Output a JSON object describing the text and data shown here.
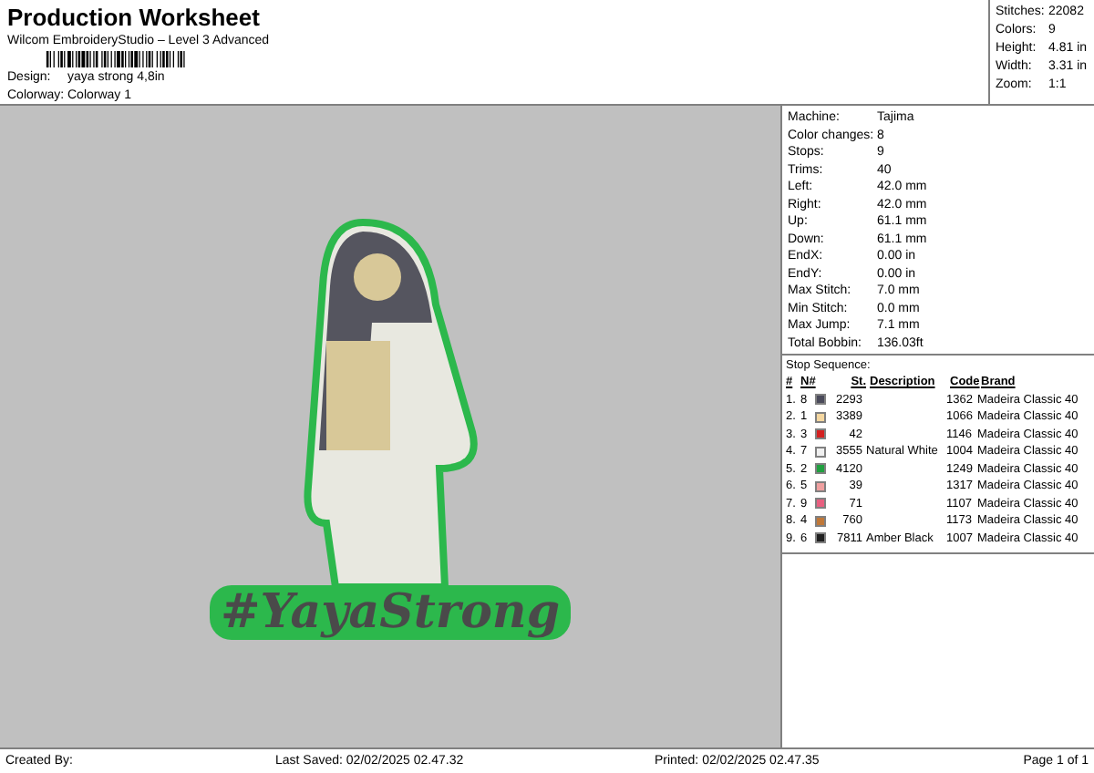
{
  "header": {
    "title": "Production Worksheet",
    "software": "Wilcom EmbroideryStudio – Level 3 Advanced",
    "fields": [
      {
        "label": "Design:",
        "value": "yaya strong 4,8in"
      },
      {
        "label": "Colorway:",
        "value": "Colorway 1"
      }
    ]
  },
  "summary": [
    {
      "label": "Stitches:",
      "value": "22082"
    },
    {
      "label": "Colors:",
      "value": "9"
    },
    {
      "label": "Height:",
      "value": "4.81 in"
    },
    {
      "label": "Width:",
      "value": "3.31 in"
    },
    {
      "label": "Zoom:",
      "value": "1:1"
    }
  ],
  "design": {
    "lettering": "#YayaStrong"
  },
  "details": [
    {
      "label": "Machine:",
      "value": "Tajima"
    },
    {
      "label": "Color changes:",
      "value": "8"
    },
    {
      "label": "Stops:",
      "value": "9"
    },
    {
      "label": "Trims:",
      "value": "40"
    },
    {
      "label": "Left:",
      "value": "42.0 mm"
    },
    {
      "label": "Right:",
      "value": "42.0 mm"
    },
    {
      "label": "Up:",
      "value": "61.1 mm"
    },
    {
      "label": "Down:",
      "value": "61.1 mm"
    },
    {
      "label": "EndX:",
      "value": "0.00 in"
    },
    {
      "label": "EndY:",
      "value": "0.00 in"
    },
    {
      "label": "Max Stitch:",
      "value": "7.0 mm"
    },
    {
      "label": "Min Stitch:",
      "value": "0.0 mm"
    },
    {
      "label": "Max Jump:",
      "value": "7.1 mm"
    },
    {
      "label": "Total Bobbin:",
      "value": "136.03ft"
    }
  ],
  "stop_sequence": {
    "title": "Stop Sequence:",
    "columns": [
      "#",
      "N#",
      "St.",
      "Description",
      "Code",
      "Brand"
    ],
    "rows": [
      {
        "index": "1.",
        "needle": "8",
        "color": "#4a4a5a",
        "stitches": "2293",
        "description": "",
        "code": "1362",
        "brand": "Madeira Classic 40"
      },
      {
        "index": "2.",
        "needle": "1",
        "color": "#f5d7a0",
        "stitches": "3389",
        "description": "",
        "code": "1066",
        "brand": "Madeira Classic 40"
      },
      {
        "index": "3.",
        "needle": "3",
        "color": "#d42020",
        "stitches": "42",
        "description": "",
        "code": "1146",
        "brand": "Madeira Classic 40"
      },
      {
        "index": "4.",
        "needle": "7",
        "color": "#f0f0f0",
        "stitches": "3555",
        "description": "Natural White",
        "code": "1004",
        "brand": "Madeira Classic 40"
      },
      {
        "index": "5.",
        "needle": "2",
        "color": "#20a040",
        "stitches": "4120",
        "description": "",
        "code": "1249",
        "brand": "Madeira Classic 40"
      },
      {
        "index": "6.",
        "needle": "5",
        "color": "#f0a0a0",
        "stitches": "39",
        "description": "",
        "code": "1317",
        "brand": "Madeira Classic 40"
      },
      {
        "index": "7.",
        "needle": "9",
        "color": "#e86080",
        "stitches": "71",
        "description": "",
        "code": "1107",
        "brand": "Madeira Classic 40"
      },
      {
        "index": "8.",
        "needle": "4",
        "color": "#c07838",
        "stitches": "760",
        "description": "",
        "code": "1173",
        "brand": "Madeira Classic 40"
      },
      {
        "index": "9.",
        "needle": "6",
        "color": "#202020",
        "stitches": "7811",
        "description": "Amber Black",
        "code": "1007",
        "brand": "Madeira Classic 40"
      }
    ]
  },
  "footer": {
    "created_by": "Created By:",
    "last_saved": "Last Saved: 02/02/2025 02.47.32",
    "printed": "Printed: 02/02/2025 02.47.35",
    "page": "Page 1 of 1"
  }
}
